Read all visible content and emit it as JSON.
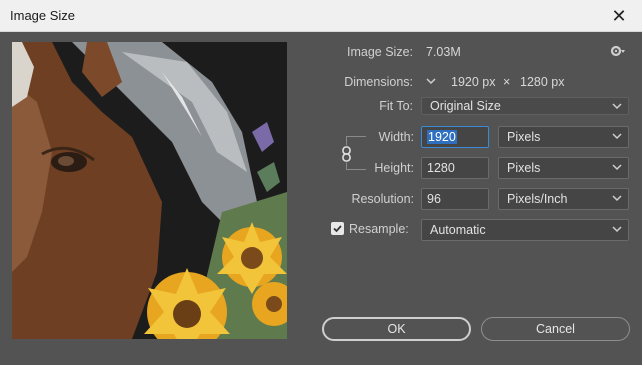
{
  "window": {
    "title": "Image Size",
    "close_glyph": "✕"
  },
  "image_size": {
    "label": "Image Size:",
    "value": "7.03M"
  },
  "dimensions": {
    "label": "Dimensions:",
    "width": "1920 px",
    "times": "×",
    "height": "1280 px"
  },
  "fit_to": {
    "label": "Fit To:",
    "value": "Original Size"
  },
  "width": {
    "label": "Width:",
    "value": "1920",
    "unit": "Pixels"
  },
  "height": {
    "label": "Height:",
    "value": "1280",
    "unit": "Pixels"
  },
  "resolution": {
    "label": "Resolution:",
    "value": "96",
    "unit": "Pixels/Inch"
  },
  "resample": {
    "label": "Resample:",
    "checked": true,
    "value": "Automatic"
  },
  "buttons": {
    "ok": "OK",
    "cancel": "Cancel"
  },
  "icons": {
    "gear": "gear-icon",
    "chain": "chain-link-icon",
    "chevron": "chevron-down-icon",
    "close": "close-icon"
  },
  "colors": {
    "dialog_bg": "#535353",
    "accent": "#3b8ad8",
    "titlebar": "#f0f0f0"
  }
}
